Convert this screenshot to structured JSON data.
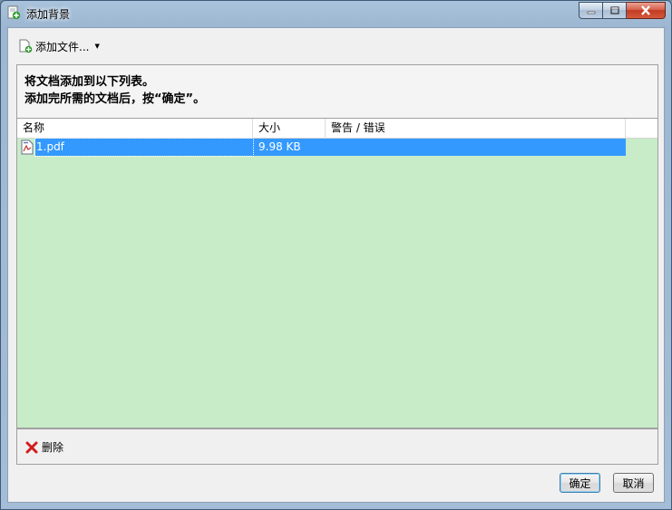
{
  "window": {
    "title": "添加背景"
  },
  "toolbar": {
    "add_files_label": "添加文件...",
    "dropdown_arrow": "▼"
  },
  "instructions": {
    "line1": "将文档添加到以下列表。",
    "line2": "添加完所需的文档后，按“确定”。"
  },
  "list": {
    "columns": {
      "name": "名称",
      "size": "大小",
      "warnings": "警告 / 错误"
    },
    "rows": [
      {
        "name": "1.pdf",
        "size": "9.98 KB",
        "warning": "",
        "selected": true
      }
    ]
  },
  "footer": {
    "delete_label": "删除"
  },
  "buttons": {
    "ok": "确定",
    "cancel": "取消"
  },
  "colors": {
    "list_bg": "#c8ecc8",
    "selection": "#3399ff",
    "close_button": "#c23a22"
  }
}
